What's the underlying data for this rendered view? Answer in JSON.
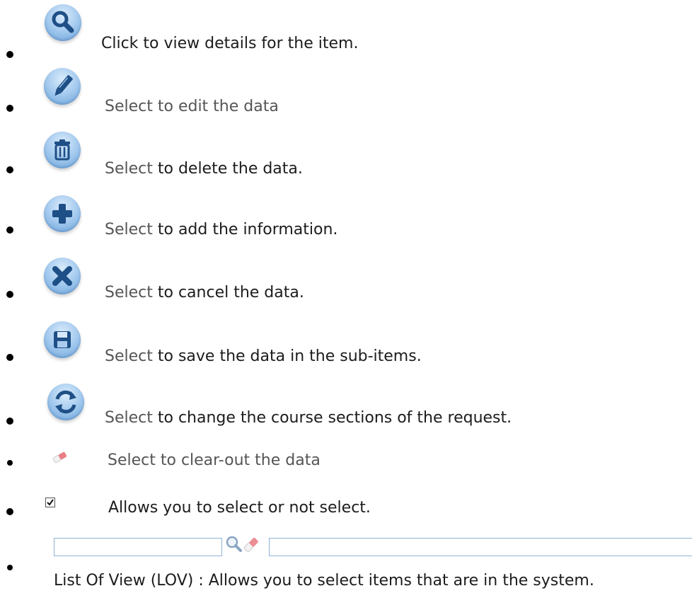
{
  "legend": {
    "items": [
      {
        "icon": "search-icon",
        "lead": "",
        "text": "Click to view details for the item."
      },
      {
        "icon": "edit-pencil-icon",
        "lead": "Select to edit the data",
        "text": ""
      },
      {
        "icon": "trash-icon",
        "lead": "Select",
        "text": " to delete the data."
      },
      {
        "icon": "add-plus-icon",
        "lead": "Select",
        "text": " to add the information."
      },
      {
        "icon": "cancel-x-icon",
        "lead": "Select",
        "text": " to cancel the data."
      },
      {
        "icon": "save-disk-icon",
        "lead": "Select",
        "text": " to save the data in the sub-items."
      },
      {
        "icon": "swap-arrows-icon",
        "lead": "Select",
        "text": " to change the course sections of the request."
      },
      {
        "icon": "eraser-icon",
        "lead": "Select to clear-out the data",
        "text": ""
      },
      {
        "icon": "checkbox-icon",
        "lead": "",
        "text": "Allows you to select or not select."
      }
    ],
    "lov": {
      "icons": [
        "search-icon",
        "eraser-icon"
      ],
      "caption": "List Of View (LOV) : Allows you to select items that are in the system."
    }
  }
}
